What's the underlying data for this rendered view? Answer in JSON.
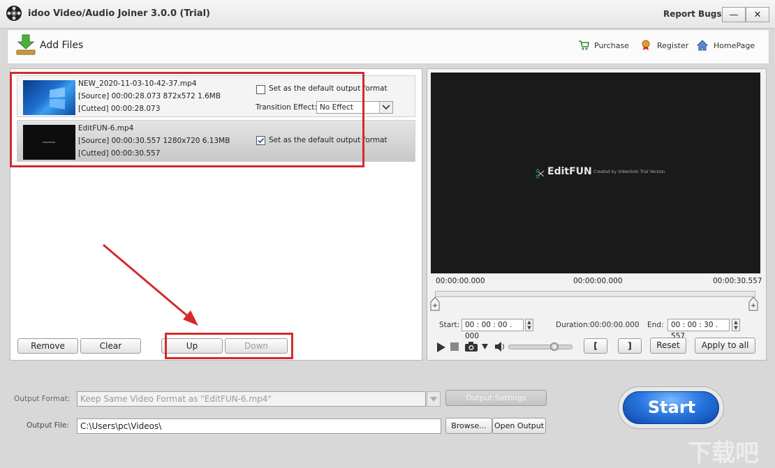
{
  "window": {
    "title": "idoo Video/Audio Joiner 3.0.0 (Trial)",
    "report_bugs": "Report Bugs",
    "minimize": "—",
    "close": "✕"
  },
  "toolbar": {
    "add_files": "Add Files",
    "purchase": "Purchase",
    "register": "Register",
    "homepage": "HomePage"
  },
  "files": [
    {
      "name": "NEW_2020-11-03-10-42-37.mp4",
      "source": "[Source]  00:00:28.073  872x572  1.6MB",
      "cutted": "[Cutted]  00:00:28.073",
      "default_label": "Set as the default output format",
      "default_checked": false,
      "transition_label": "Transition Effect:",
      "transition_value": "No Effect"
    },
    {
      "name": "EditFUN-6.mp4",
      "source": "[Source]  00:00:30.557  1280x720  6.13MB",
      "cutted": "[Cutted]  00:00:30.557",
      "default_label": "Set as the default output format",
      "default_checked": true
    }
  ],
  "list_buttons": {
    "remove": "Remove",
    "clear": "Clear",
    "up": "Up",
    "down": "Down"
  },
  "preview": {
    "logo_text": "EditFUN",
    "logo_sub": "Created by VideoSolo Trial Version",
    "time_left": "00:00:00.000",
    "time_mid": "00:00:00.000",
    "time_right": "00:00:30.557",
    "start_label": "Start:",
    "start_value": "00 : 00 : 00 . 000",
    "duration_label": "Duration:",
    "duration_value": "00:00:00.000",
    "end_label": "End:",
    "end_value": "00 : 00 : 30 . 557",
    "mark_in": "[",
    "mark_out": "]",
    "reset": "Reset",
    "apply_all": "Apply to all",
    "volume_level": 0.75
  },
  "output": {
    "format_label": "Output Format:",
    "format_value": "Keep Same Video Format as \"EditFUN-6.mp4\"",
    "settings_button": "Output Settings",
    "file_label": "Output File:",
    "file_value": "C:\\Users\\pc\\Videos\\",
    "browse": "Browse...",
    "open_output": "Open Output",
    "start": "Start"
  },
  "watermark": "下载吧",
  "colors": {
    "accent_red": "#d42a2a",
    "start_blue": "#1a5fc8",
    "preview_bg": "#1a1a1a"
  }
}
